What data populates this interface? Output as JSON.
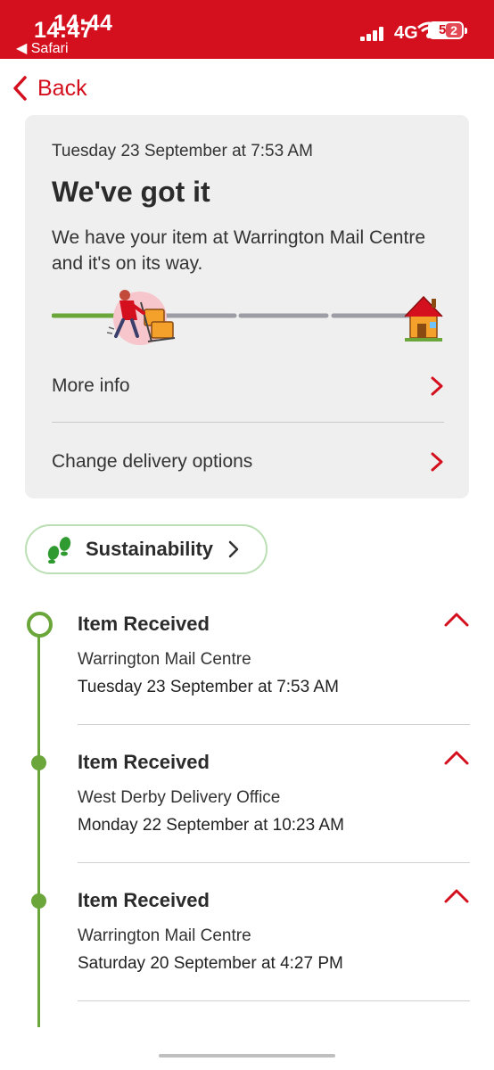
{
  "status_bar": {
    "time_primary": "14:44",
    "time_secondary": "14:47",
    "back_to_app": "◀ Safari",
    "network": "4G",
    "battery_level": "5",
    "battery_badge": "2"
  },
  "nav": {
    "back_label": "Back"
  },
  "tracking_card": {
    "date": "Tuesday 23 September at 7:53 AM",
    "title": "We've got it",
    "description": "We have your item at Warrington Mail Centre and it's on its way.",
    "progress_stage": 1,
    "progress_total": 5,
    "rows": [
      {
        "label": "More info"
      },
      {
        "label": "Change delivery options"
      }
    ]
  },
  "sustainability": {
    "label": "Sustainability"
  },
  "events": [
    {
      "title": "Item Received",
      "location": "Warrington Mail Centre",
      "datetime": "Tuesday 23 September at 7:53 AM"
    },
    {
      "title": "Item Received",
      "location": "West Derby Delivery Office",
      "datetime": "Monday 22 September at 10:23 AM"
    },
    {
      "title": "Item Received",
      "location": "Warrington Mail Centre",
      "datetime": "Saturday 20 September at 4:27 PM"
    }
  ],
  "colors": {
    "brand_red": "#d4101f",
    "timeline_green": "#6aa63a",
    "card_background": "#efefef"
  }
}
